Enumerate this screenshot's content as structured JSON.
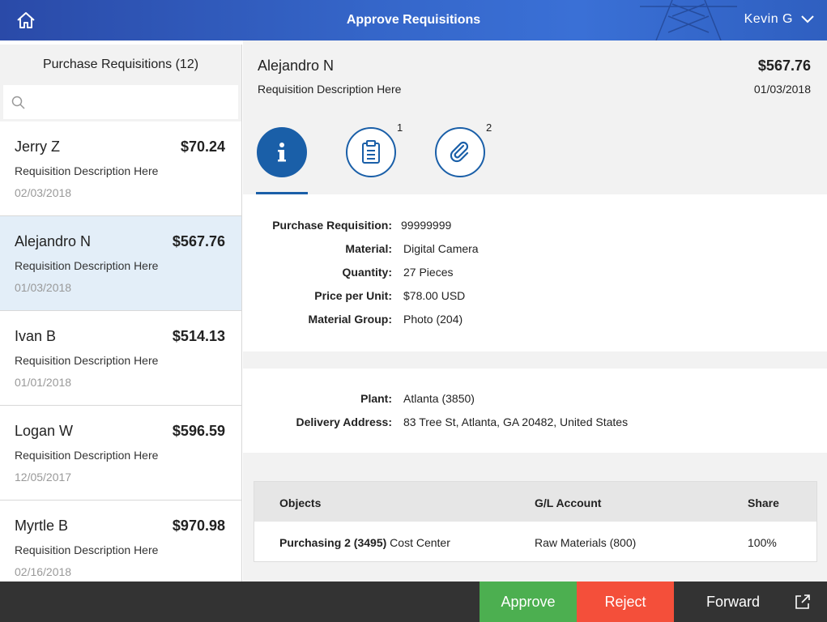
{
  "header": {
    "title": "Approve Requisitions",
    "user": "Kevin G"
  },
  "sidebar": {
    "title": "Purchase Requisitions (12)",
    "search_placeholder": "",
    "items": [
      {
        "name": "Jerry Z",
        "amount": "$70.24",
        "desc": "Requisition Description Here",
        "date": "02/03/2018"
      },
      {
        "name": "Alejandro N",
        "amount": "$567.76",
        "desc": "Requisition Description Here",
        "date": "01/03/2018"
      },
      {
        "name": "Ivan B",
        "amount": "$514.13",
        "desc": "Requisition Description Here",
        "date": "01/01/2018"
      },
      {
        "name": "Logan W",
        "amount": "$596.59",
        "desc": "Requisition Description Here",
        "date": "12/05/2017"
      },
      {
        "name": "Myrtle B",
        "amount": "$970.98",
        "desc": "Requisition Description Here",
        "date": "02/16/2018"
      }
    ]
  },
  "detail": {
    "name": "Alejandro N",
    "amount": "$567.76",
    "desc": "Requisition Description Here",
    "date": "01/03/2018",
    "tabs": [
      {
        "icon": "info-icon",
        "count": ""
      },
      {
        "icon": "clipboard-icon",
        "count": "1"
      },
      {
        "icon": "paperclip-icon",
        "count": "2"
      }
    ],
    "fields1": [
      {
        "label": "Purchase Requisition:",
        "value": "99999999"
      },
      {
        "label": "Material:",
        "value": "Digital Camera"
      },
      {
        "label": "Quantity:",
        "value": "27 Pieces"
      },
      {
        "label": "Price per Unit:",
        "value": "$78.00 USD"
      },
      {
        "label": "Material Group:",
        "value": "Photo (204)"
      }
    ],
    "fields2": [
      {
        "label": "Plant:",
        "value": "Atlanta (3850)"
      },
      {
        "label": "Delivery Address:",
        "value": "83 Tree St, Atlanta, GA 20482, United States"
      }
    ],
    "table": {
      "headers": [
        "Objects",
        "G/L Account",
        "Share"
      ],
      "row": {
        "object_bold": "Purchasing 2 (3495)",
        "object_rest": " Cost Center",
        "gl": "Raw Materials (800)",
        "share": "100%"
      }
    }
  },
  "footer": {
    "approve": "Approve",
    "reject": "Reject",
    "forward": "Forward"
  },
  "colors": {
    "brand": "#1a5fa8",
    "approve": "#4caf50",
    "reject": "#f44f3a",
    "selected": "#e3eef8"
  }
}
